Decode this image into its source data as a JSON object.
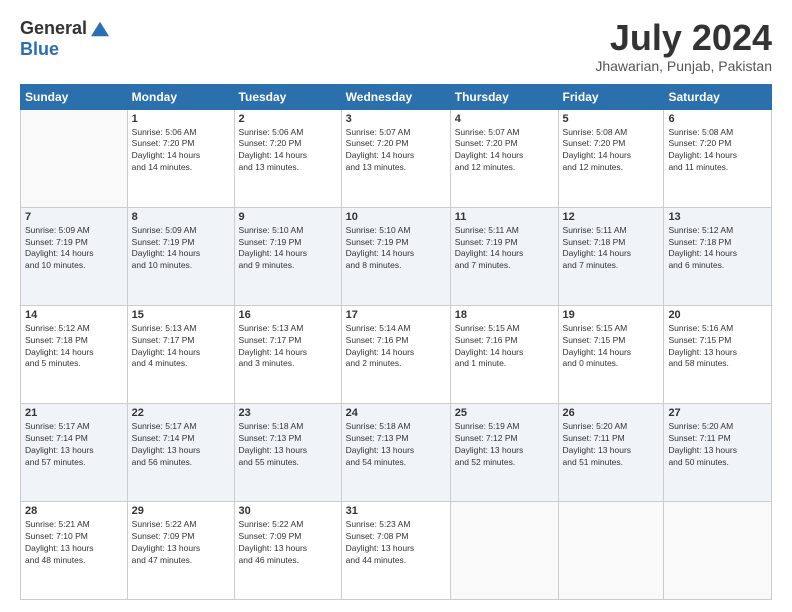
{
  "logo": {
    "general": "General",
    "blue": "Blue"
  },
  "title": "July 2024",
  "location": "Jhawarian, Punjab, Pakistan",
  "headers": [
    "Sunday",
    "Monday",
    "Tuesday",
    "Wednesday",
    "Thursday",
    "Friday",
    "Saturday"
  ],
  "weeks": [
    [
      {
        "day": "",
        "info": ""
      },
      {
        "day": "1",
        "info": "Sunrise: 5:06 AM\nSunset: 7:20 PM\nDaylight: 14 hours\nand 14 minutes."
      },
      {
        "day": "2",
        "info": "Sunrise: 5:06 AM\nSunset: 7:20 PM\nDaylight: 14 hours\nand 13 minutes."
      },
      {
        "day": "3",
        "info": "Sunrise: 5:07 AM\nSunset: 7:20 PM\nDaylight: 14 hours\nand 13 minutes."
      },
      {
        "day": "4",
        "info": "Sunrise: 5:07 AM\nSunset: 7:20 PM\nDaylight: 14 hours\nand 12 minutes."
      },
      {
        "day": "5",
        "info": "Sunrise: 5:08 AM\nSunset: 7:20 PM\nDaylight: 14 hours\nand 12 minutes."
      },
      {
        "day": "6",
        "info": "Sunrise: 5:08 AM\nSunset: 7:20 PM\nDaylight: 14 hours\nand 11 minutes."
      }
    ],
    [
      {
        "day": "7",
        "info": "Sunrise: 5:09 AM\nSunset: 7:19 PM\nDaylight: 14 hours\nand 10 minutes."
      },
      {
        "day": "8",
        "info": "Sunrise: 5:09 AM\nSunset: 7:19 PM\nDaylight: 14 hours\nand 10 minutes."
      },
      {
        "day": "9",
        "info": "Sunrise: 5:10 AM\nSunset: 7:19 PM\nDaylight: 14 hours\nand 9 minutes."
      },
      {
        "day": "10",
        "info": "Sunrise: 5:10 AM\nSunset: 7:19 PM\nDaylight: 14 hours\nand 8 minutes."
      },
      {
        "day": "11",
        "info": "Sunrise: 5:11 AM\nSunset: 7:19 PM\nDaylight: 14 hours\nand 7 minutes."
      },
      {
        "day": "12",
        "info": "Sunrise: 5:11 AM\nSunset: 7:18 PM\nDaylight: 14 hours\nand 7 minutes."
      },
      {
        "day": "13",
        "info": "Sunrise: 5:12 AM\nSunset: 7:18 PM\nDaylight: 14 hours\nand 6 minutes."
      }
    ],
    [
      {
        "day": "14",
        "info": "Sunrise: 5:12 AM\nSunset: 7:18 PM\nDaylight: 14 hours\nand 5 minutes."
      },
      {
        "day": "15",
        "info": "Sunrise: 5:13 AM\nSunset: 7:17 PM\nDaylight: 14 hours\nand 4 minutes."
      },
      {
        "day": "16",
        "info": "Sunrise: 5:13 AM\nSunset: 7:17 PM\nDaylight: 14 hours\nand 3 minutes."
      },
      {
        "day": "17",
        "info": "Sunrise: 5:14 AM\nSunset: 7:16 PM\nDaylight: 14 hours\nand 2 minutes."
      },
      {
        "day": "18",
        "info": "Sunrise: 5:15 AM\nSunset: 7:16 PM\nDaylight: 14 hours\nand 1 minute."
      },
      {
        "day": "19",
        "info": "Sunrise: 5:15 AM\nSunset: 7:15 PM\nDaylight: 14 hours\nand 0 minutes."
      },
      {
        "day": "20",
        "info": "Sunrise: 5:16 AM\nSunset: 7:15 PM\nDaylight: 13 hours\nand 58 minutes."
      }
    ],
    [
      {
        "day": "21",
        "info": "Sunrise: 5:17 AM\nSunset: 7:14 PM\nDaylight: 13 hours\nand 57 minutes."
      },
      {
        "day": "22",
        "info": "Sunrise: 5:17 AM\nSunset: 7:14 PM\nDaylight: 13 hours\nand 56 minutes."
      },
      {
        "day": "23",
        "info": "Sunrise: 5:18 AM\nSunset: 7:13 PM\nDaylight: 13 hours\nand 55 minutes."
      },
      {
        "day": "24",
        "info": "Sunrise: 5:18 AM\nSunset: 7:13 PM\nDaylight: 13 hours\nand 54 minutes."
      },
      {
        "day": "25",
        "info": "Sunrise: 5:19 AM\nSunset: 7:12 PM\nDaylight: 13 hours\nand 52 minutes."
      },
      {
        "day": "26",
        "info": "Sunrise: 5:20 AM\nSunset: 7:11 PM\nDaylight: 13 hours\nand 51 minutes."
      },
      {
        "day": "27",
        "info": "Sunrise: 5:20 AM\nSunset: 7:11 PM\nDaylight: 13 hours\nand 50 minutes."
      }
    ],
    [
      {
        "day": "28",
        "info": "Sunrise: 5:21 AM\nSunset: 7:10 PM\nDaylight: 13 hours\nand 48 minutes."
      },
      {
        "day": "29",
        "info": "Sunrise: 5:22 AM\nSunset: 7:09 PM\nDaylight: 13 hours\nand 47 minutes."
      },
      {
        "day": "30",
        "info": "Sunrise: 5:22 AM\nSunset: 7:09 PM\nDaylight: 13 hours\nand 46 minutes."
      },
      {
        "day": "31",
        "info": "Sunrise: 5:23 AM\nSunset: 7:08 PM\nDaylight: 13 hours\nand 44 minutes."
      },
      {
        "day": "",
        "info": ""
      },
      {
        "day": "",
        "info": ""
      },
      {
        "day": "",
        "info": ""
      }
    ]
  ]
}
